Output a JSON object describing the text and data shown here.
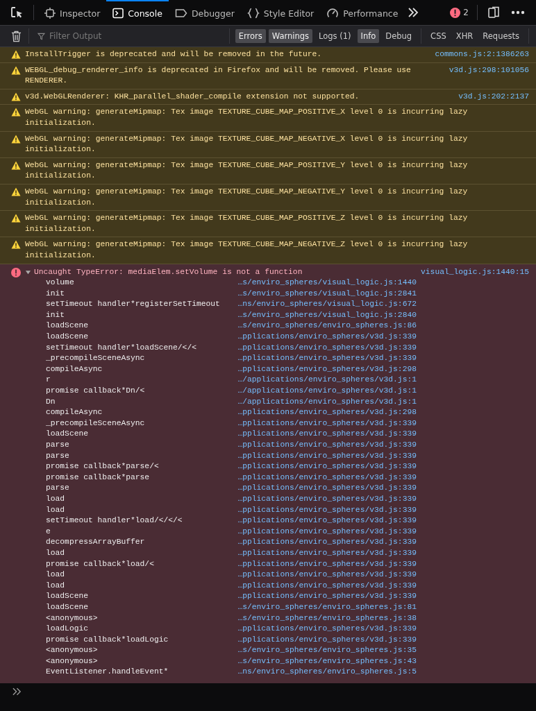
{
  "toolbar": {
    "tabs": [
      {
        "label": "Inspector",
        "kind": "inspector",
        "selected": false
      },
      {
        "label": "Console",
        "kind": "console",
        "selected": true
      },
      {
        "label": "Debugger",
        "kind": "debugger",
        "selected": false
      },
      {
        "label": "Style Editor",
        "kind": "style",
        "selected": false
      },
      {
        "label": "Performance",
        "kind": "performance",
        "selected": false
      }
    ],
    "error_count": "2"
  },
  "filter_bar": {
    "placeholder": "Filter Output",
    "levels": [
      {
        "label": "Errors",
        "selected": true
      },
      {
        "label": "Warnings",
        "selected": true
      },
      {
        "label": "Logs (1)",
        "selected": false
      },
      {
        "label": "Info",
        "selected": true
      },
      {
        "label": "Debug",
        "selected": false
      }
    ],
    "request_filters": [
      {
        "label": "CSS",
        "selected": false
      },
      {
        "label": "XHR",
        "selected": false
      },
      {
        "label": "Requests",
        "selected": false
      }
    ]
  },
  "messages": [
    {
      "kind": "warning",
      "text": "InstallTrigger is deprecated and will be removed in the future.",
      "location": "commons.js:2:1386263"
    },
    {
      "kind": "warning",
      "text": "WEBGL_debug_renderer_info is deprecated in Firefox and will be removed. Please use RENDERER.",
      "location": "v3d.js:298:101056"
    },
    {
      "kind": "warning",
      "text": "v3d.WebGLRenderer: KHR_parallel_shader_compile extension not supported.",
      "location": "v3d.js:202:2137"
    },
    {
      "kind": "warning",
      "text": "WebGL warning: generateMipmap: Tex image TEXTURE_CUBE_MAP_POSITIVE_X level 0 is incurring lazy initialization."
    },
    {
      "kind": "warning",
      "text": "WebGL warning: generateMipmap: Tex image TEXTURE_CUBE_MAP_NEGATIVE_X level 0 is incurring lazy initialization."
    },
    {
      "kind": "warning",
      "text": "WebGL warning: generateMipmap: Tex image TEXTURE_CUBE_MAP_POSITIVE_Y level 0 is incurring lazy initialization."
    },
    {
      "kind": "warning",
      "text": "WebGL warning: generateMipmap: Tex image TEXTURE_CUBE_MAP_NEGATIVE_Y level 0 is incurring lazy initialization."
    },
    {
      "kind": "warning",
      "text": "WebGL warning: generateMipmap: Tex image TEXTURE_CUBE_MAP_POSITIVE_Z level 0 is incurring lazy initialization."
    },
    {
      "kind": "warning",
      "text": "WebGL warning: generateMipmap: Tex image TEXTURE_CUBE_MAP_NEGATIVE_Z level 0 is incurring lazy initialization."
    },
    {
      "kind": "error",
      "text": "Uncaught TypeError: mediaElem.setVolume is not a function",
      "location": "visual_logic.js:1440:15",
      "expanded": true,
      "frames": [
        {
          "function": "volume",
          "location": "…s/enviro_spheres/visual_logic.js:1440"
        },
        {
          "function": "init",
          "location": "…s/enviro_spheres/visual_logic.js:2841"
        },
        {
          "function": "setTimeout handler*registerSetTimeout",
          "location": "…ns/enviro_spheres/visual_logic.js:672"
        },
        {
          "function": "init",
          "location": "…s/enviro_spheres/visual_logic.js:2840"
        },
        {
          "function": "loadScene",
          "location": "…s/enviro_spheres/enviro_spheres.js:86"
        },
        {
          "function": "loadScene",
          "location": "…pplications/enviro_spheres/v3d.js:339"
        },
        {
          "function": "setTimeout handler*loadScene/</<",
          "location": "…pplications/enviro_spheres/v3d.js:339"
        },
        {
          "function": "_precompileSceneAsync",
          "location": "…pplications/enviro_spheres/v3d.js:339"
        },
        {
          "function": "compileAsync",
          "location": "…pplications/enviro_spheres/v3d.js:298"
        },
        {
          "function": "r",
          "location": "…/applications/enviro_spheres/v3d.js:1"
        },
        {
          "function": "promise callback*Dn/<",
          "location": "…/applications/enviro_spheres/v3d.js:1"
        },
        {
          "function": "Dn",
          "location": "…/applications/enviro_spheres/v3d.js:1"
        },
        {
          "function": "compileAsync",
          "location": "…pplications/enviro_spheres/v3d.js:298"
        },
        {
          "function": "_precompileSceneAsync",
          "location": "…pplications/enviro_spheres/v3d.js:339"
        },
        {
          "function": "loadScene",
          "location": "…pplications/enviro_spheres/v3d.js:339"
        },
        {
          "function": "parse",
          "location": "…pplications/enviro_spheres/v3d.js:339"
        },
        {
          "function": "parse",
          "location": "…pplications/enviro_spheres/v3d.js:339"
        },
        {
          "function": "promise callback*parse/<",
          "location": "…pplications/enviro_spheres/v3d.js:339"
        },
        {
          "function": "promise callback*parse",
          "location": "…pplications/enviro_spheres/v3d.js:339"
        },
        {
          "function": "parse",
          "location": "…pplications/enviro_spheres/v3d.js:339"
        },
        {
          "function": "load",
          "location": "…pplications/enviro_spheres/v3d.js:339"
        },
        {
          "function": "load",
          "location": "…pplications/enviro_spheres/v3d.js:339"
        },
        {
          "function": "setTimeout handler*load/</</<",
          "location": "…pplications/enviro_spheres/v3d.js:339"
        },
        {
          "function": "e",
          "location": "…pplications/enviro_spheres/v3d.js:339"
        },
        {
          "function": "decompressArrayBuffer",
          "location": "…pplications/enviro_spheres/v3d.js:339"
        },
        {
          "function": "load",
          "location": "…pplications/enviro_spheres/v3d.js:339"
        },
        {
          "function": "promise callback*load/<",
          "location": "…pplications/enviro_spheres/v3d.js:339"
        },
        {
          "function": "load",
          "location": "…pplications/enviro_spheres/v3d.js:339"
        },
        {
          "function": "load",
          "location": "…pplications/enviro_spheres/v3d.js:339"
        },
        {
          "function": "loadScene",
          "location": "…pplications/enviro_spheres/v3d.js:339"
        },
        {
          "function": "loadScene",
          "location": "…s/enviro_spheres/enviro_spheres.js:81"
        },
        {
          "function": "<anonymous>",
          "location": "…s/enviro_spheres/enviro_spheres.js:38"
        },
        {
          "function": "loadLogic",
          "location": "…pplications/enviro_spheres/v3d.js:339"
        },
        {
          "function": "promise callback*loadLogic",
          "location": "…pplications/enviro_spheres/v3d.js:339"
        },
        {
          "function": "<anonymous>",
          "location": "…s/enviro_spheres/enviro_spheres.js:35"
        },
        {
          "function": "<anonymous>",
          "location": "…s/enviro_spheres/enviro_spheres.js:43"
        },
        {
          "function": "EventListener.handleEvent*",
          "location": "…ns/enviro_spheres/enviro_spheres.js:5"
        }
      ]
    }
  ]
}
